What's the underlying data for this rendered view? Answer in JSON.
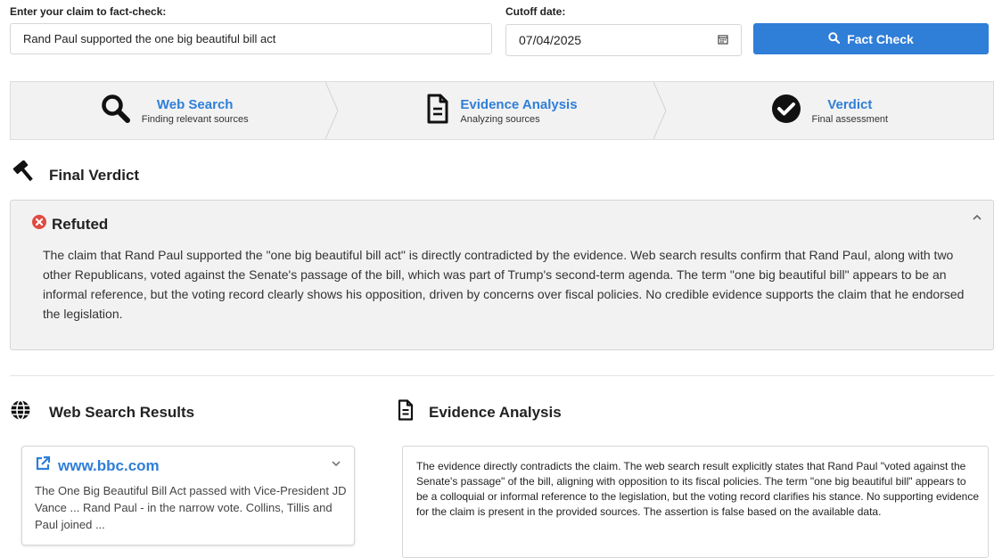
{
  "form": {
    "claim_label": "Enter your claim to fact-check:",
    "claim_value": "Rand Paul supported the one big beautiful bill act",
    "cutoff_label": "Cutoff date:",
    "cutoff_value": "07/04/2025",
    "submit_label": "Fact Check"
  },
  "steps": [
    {
      "icon": "search-icon",
      "title": "Web Search",
      "subtitle": "Finding relevant sources"
    },
    {
      "icon": "document-icon",
      "title": "Evidence Analysis",
      "subtitle": "Analyzing sources"
    },
    {
      "icon": "check-circle-icon",
      "title": "Verdict",
      "subtitle": "Final assessment"
    }
  ],
  "final_verdict": {
    "heading": "Final Verdict",
    "status": "Refuted",
    "status_color": "#e04a3f",
    "explanation": "The claim that Rand Paul supported the \"one big beautiful bill act\" is directly contradicted by the evidence. Web search results confirm that Rand Paul, along with two other Republicans, voted against the Senate's passage of the bill, which was part of Trump's second-term agenda. The term \"one big beautiful bill\" appears to be an informal reference, but the voting record clearly shows his opposition, driven by concerns over fiscal policies. No credible evidence supports the claim that he endorsed the legislation."
  },
  "web_results": {
    "heading": "Web Search Results",
    "items": [
      {
        "source": "www.bbc.com",
        "snippet": "The One Big Beautiful Bill Act passed with Vice-President JD Vance ... Rand Paul - in the narrow vote. Collins, Tillis and Paul joined ..."
      }
    ]
  },
  "evidence_analysis": {
    "heading": "Evidence Analysis",
    "text": "The evidence directly contradicts the claim. The web search result explicitly states that Rand Paul \"voted against the Senate's passage\" of the bill, aligning with opposition to its fiscal policies. The term \"one big beautiful bill\" appears to be a colloquial or informal reference to the legislation, but the voting record clarifies his stance. No supporting evidence for the claim is present in the provided sources. The assertion is false based on the available data."
  },
  "colors": {
    "accent": "#2f7ed8",
    "panel": "#f2f2f2"
  }
}
